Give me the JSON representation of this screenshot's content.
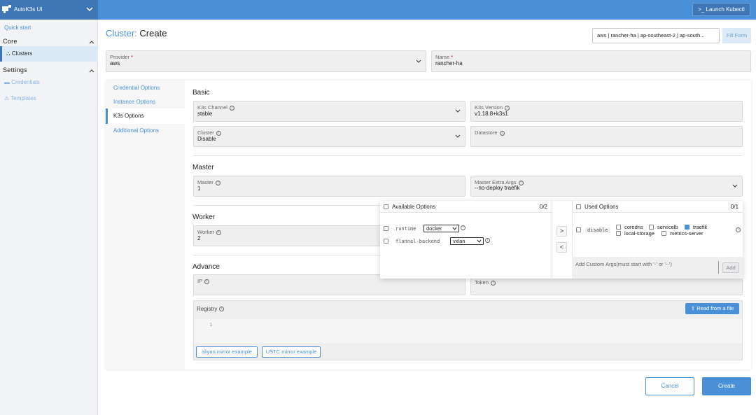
{
  "brand": {
    "title": "AutoK3s UI"
  },
  "topbar": {
    "kubectl_label": "Launch Kubectl",
    "kubectl_icon": ">_"
  },
  "sidebar": {
    "quick_start": "Quick start",
    "core_label": "Core",
    "clusters_label": "Clusters",
    "settings_label": "Settings",
    "credentials_label": "Credentials",
    "templates_label": "Templates"
  },
  "page": {
    "title_prefix": "Cluster:",
    "title_action": "Create",
    "summary": "aws | rancher-ha | ap-southeast-2 | ap-south...",
    "fill_form_label": "Fill Form"
  },
  "top_fields": {
    "provider": {
      "label": "Provider",
      "value": "aws"
    },
    "name": {
      "label": "Name",
      "value": "rancher-ha"
    }
  },
  "tabs": [
    "Credential Options",
    "Instance Options",
    "K3s Options",
    "Additional Options"
  ],
  "sections": {
    "basic": "Basic",
    "master": "Master",
    "worker": "Worker",
    "advance": "Advance"
  },
  "fields": {
    "k3s_channel": {
      "label": "K3s Channel",
      "value": "stable"
    },
    "k3s_version": {
      "label": "K3s Version",
      "value": "v1.18.8+k3s1"
    },
    "cluster": {
      "label": "Cluster",
      "value": "Disable"
    },
    "datastore": {
      "label": "Datastore",
      "value": ""
    },
    "master": {
      "label": "Master",
      "value": "1"
    },
    "master_extra_args": {
      "label": "Master Extra Args",
      "value": "--no-deploy traefik"
    },
    "worker": {
      "label": "Worker",
      "value": "2"
    },
    "ip": {
      "label": "IP",
      "value": ""
    },
    "token": {
      "label": "Token",
      "value": ""
    }
  },
  "registry": {
    "label": "Registry",
    "line_number": "1",
    "read_button": "Read from a file",
    "aliyun_button": "aliyun mirror example",
    "ustc_button": "USTC mirror example"
  },
  "transfer": {
    "available": {
      "title": "Available Options",
      "count": "0/2",
      "items": [
        {
          "name": "runtime",
          "selected": "docker"
        },
        {
          "name": "flannel-backend",
          "selected": "vxlan"
        }
      ]
    },
    "used": {
      "title": "Used Options",
      "count": "0/1",
      "item_name": "disable",
      "choices": [
        {
          "label": "coredns",
          "checked": false
        },
        {
          "label": "servicelb",
          "checked": false
        },
        {
          "label": "traefik",
          "checked": true
        },
        {
          "label": "local-storage",
          "checked": false
        },
        {
          "label": "metrics-server",
          "checked": false
        }
      ]
    },
    "move_right": ">",
    "move_left": "<",
    "custom_args_placeholder": "Add Custom Args(must start with '-' or '--')",
    "add_label": "Add"
  },
  "footer": {
    "cancel": "Cancel",
    "create": "Create"
  },
  "colors": {
    "accent": "#4a90d9",
    "brand": "#3f77b6",
    "active_bg": "#dce9f7"
  }
}
